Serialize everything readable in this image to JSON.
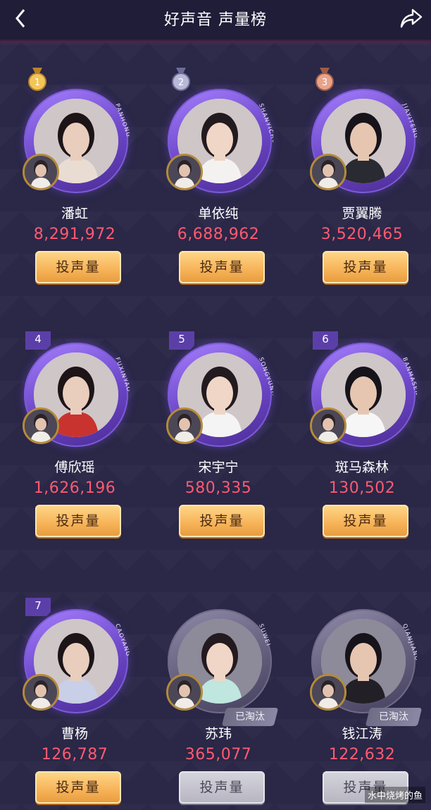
{
  "header": {
    "title": "好声音 声量榜",
    "back_icon": "chevron-left-icon",
    "share_icon": "share-icon"
  },
  "vote_label": "投声量",
  "eliminated_label": "已淘汰",
  "colors": {
    "background": "#2a2747",
    "votes": "#ff5a70",
    "button": "#f6b257",
    "frame": "#6a45c6"
  },
  "contestants": [
    {
      "rank": "1",
      "name": "潘虹",
      "votes": "8,291,972",
      "arc": "PANHONG",
      "medal": "gold",
      "eliminated": false
    },
    {
      "rank": "2",
      "name": "单依纯",
      "votes": "6,688,962",
      "arc": "SHANYICHUN",
      "medal": "silver",
      "eliminated": false
    },
    {
      "rank": "3",
      "name": "贾翼腾",
      "votes": "3,520,465",
      "arc": "JIAYITENG",
      "medal": "bronze",
      "eliminated": false
    },
    {
      "rank": "4",
      "name": "傅欣瑶",
      "votes": "1,626,196",
      "arc": "FUXINYAO",
      "medal": "",
      "eliminated": false
    },
    {
      "rank": "5",
      "name": "宋宇宁",
      "votes": "580,335",
      "arc": "SONGYUNING",
      "medal": "",
      "eliminated": false
    },
    {
      "rank": "6",
      "name": "斑马森林",
      "votes": "130,502",
      "arc": "BANMASENLIN",
      "medal": "",
      "eliminated": false
    },
    {
      "rank": "7",
      "name": "曹杨",
      "votes": "126,787",
      "arc": "CAOYANG",
      "medal": "",
      "eliminated": false
    },
    {
      "rank": "",
      "name": "苏玮",
      "votes": "365,077",
      "arc": "SUWEI",
      "medal": "",
      "eliminated": true
    },
    {
      "rank": "",
      "name": "钱江涛",
      "votes": "122,632",
      "arc": "QIANJIANGTAO",
      "medal": "",
      "eliminated": true
    }
  ],
  "watermark": "水中烧烤的鱼"
}
